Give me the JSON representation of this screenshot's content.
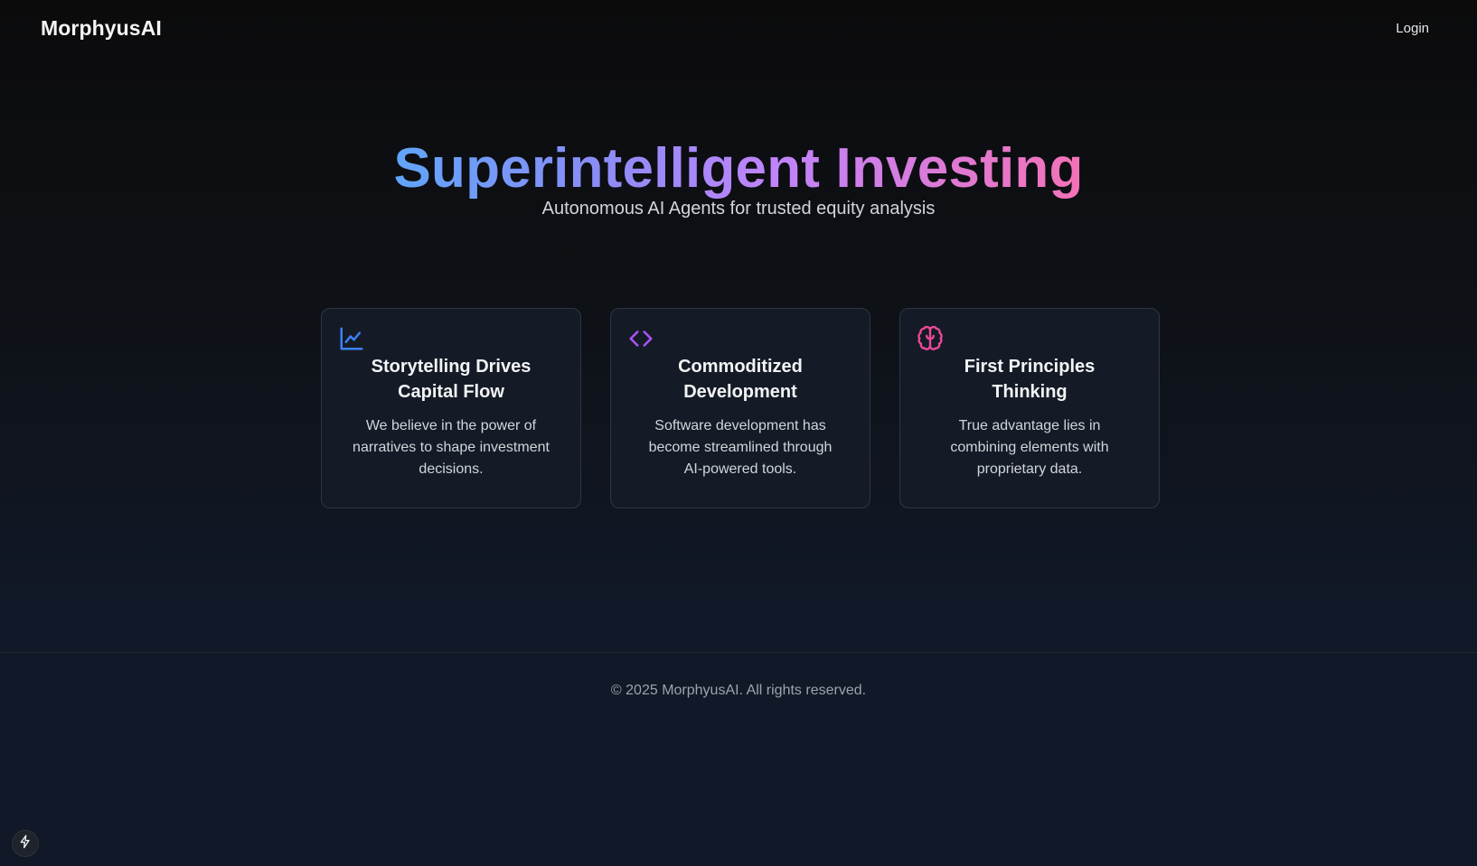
{
  "header": {
    "brand": "MorphyusAI",
    "login_label": "Login"
  },
  "hero": {
    "title": "Superintelligent Investing",
    "subtitle": "Autonomous AI Agents for trusted equity analysis"
  },
  "cards": [
    {
      "icon": "line-chart-icon",
      "icon_color": "#3b82f6",
      "title": "Storytelling Drives Capital Flow",
      "description": "We believe in the power of narratives to shape investment decisions."
    },
    {
      "icon": "code-icon",
      "icon_color": "#a855f7",
      "title": "Commoditized Development",
      "description": "Software development has become streamlined through AI-powered tools."
    },
    {
      "icon": "brain-icon",
      "icon_color": "#ec4899",
      "title": "First Principles Thinking",
      "description": "True advantage lies in combining elements with proprietary data."
    }
  ],
  "footer": {
    "copyright": "© 2025 MorphyusAI. All rights reserved."
  },
  "floating_button": {
    "icon": "lightning-bolt-icon"
  }
}
